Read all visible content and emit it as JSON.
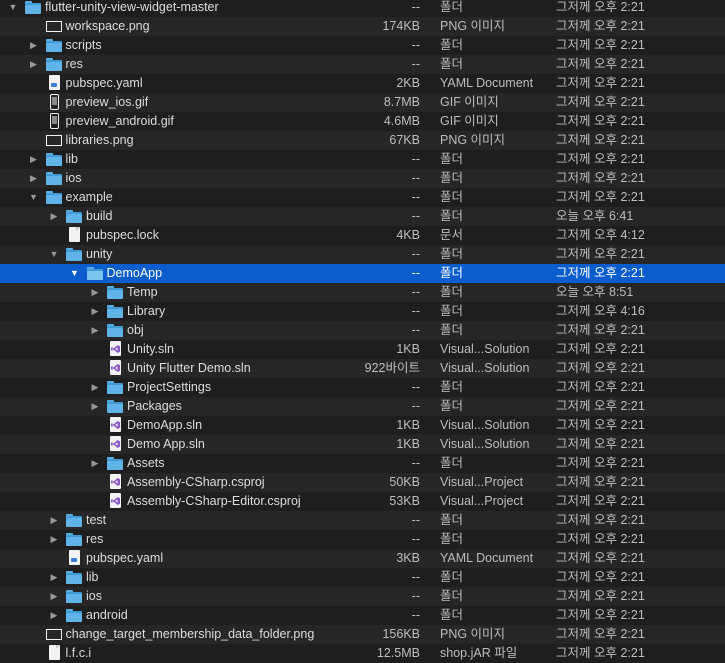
{
  "rows": [
    {
      "indent": 0,
      "disclosure": "open",
      "icon": "folder-icon",
      "name": "flutter-unity-view-widget-master",
      "size": "--",
      "kind": "폴더",
      "date": "그저께 오후 2:21"
    },
    {
      "indent": 1,
      "disclosure": "none",
      "icon": "png-file-icon",
      "name": "workspace.png",
      "size": "174KB",
      "kind": "PNG 이미지",
      "date": "그저께 오후 2:21"
    },
    {
      "indent": 1,
      "disclosure": "closed",
      "icon": "folder-icon",
      "name": "scripts",
      "size": "--",
      "kind": "폴더",
      "date": "그저께 오후 2:21"
    },
    {
      "indent": 1,
      "disclosure": "closed",
      "icon": "folder-icon",
      "name": "res",
      "size": "--",
      "kind": "폴더",
      "date": "그저께 오후 2:21"
    },
    {
      "indent": 1,
      "disclosure": "none",
      "icon": "yaml-file-icon",
      "name": "pubspec.yaml",
      "size": "2KB",
      "kind": "YAML Document",
      "date": "그저께 오후 2:21"
    },
    {
      "indent": 1,
      "disclosure": "none",
      "icon": "gif-file-icon",
      "name": "preview_ios.gif",
      "size": "8.7MB",
      "kind": "GIF 이미지",
      "date": "그저께 오후 2:21"
    },
    {
      "indent": 1,
      "disclosure": "none",
      "icon": "gif-file-icon",
      "name": "preview_android.gif",
      "size": "4.6MB",
      "kind": "GIF 이미지",
      "date": "그저께 오후 2:21"
    },
    {
      "indent": 1,
      "disclosure": "none",
      "icon": "png-file-icon",
      "name": "libraries.png",
      "size": "67KB",
      "kind": "PNG 이미지",
      "date": "그저께 오후 2:21"
    },
    {
      "indent": 1,
      "disclosure": "closed",
      "icon": "folder-icon",
      "name": "lib",
      "size": "--",
      "kind": "폴더",
      "date": "그저께 오후 2:21"
    },
    {
      "indent": 1,
      "disclosure": "closed",
      "icon": "folder-icon",
      "name": "ios",
      "size": "--",
      "kind": "폴더",
      "date": "그저께 오후 2:21"
    },
    {
      "indent": 1,
      "disclosure": "open",
      "icon": "folder-icon",
      "name": "example",
      "size": "--",
      "kind": "폴더",
      "date": "그저께 오후 2:21"
    },
    {
      "indent": 2,
      "disclosure": "closed",
      "icon": "folder-icon",
      "name": "build",
      "size": "--",
      "kind": "폴더",
      "date": "오늘 오후 6:41"
    },
    {
      "indent": 2,
      "disclosure": "none",
      "icon": "document-icon",
      "name": "pubspec.lock",
      "size": "4KB",
      "kind": "문서",
      "date": "그저께 오후 4:12"
    },
    {
      "indent": 2,
      "disclosure": "open",
      "icon": "folder-icon",
      "name": "unity",
      "size": "--",
      "kind": "폴더",
      "date": "그저께 오후 2:21"
    },
    {
      "indent": 3,
      "disclosure": "open",
      "icon": "folder-icon",
      "name": "DemoApp",
      "size": "--",
      "kind": "폴더",
      "date": "그저께 오후 2:21",
      "selected": true
    },
    {
      "indent": 4,
      "disclosure": "closed",
      "icon": "folder-icon",
      "name": "Temp",
      "size": "--",
      "kind": "폴더",
      "date": "오늘 오후 8:51"
    },
    {
      "indent": 4,
      "disclosure": "closed",
      "icon": "folder-icon",
      "name": "Library",
      "size": "--",
      "kind": "폴더",
      "date": "그저께 오후 4:16"
    },
    {
      "indent": 4,
      "disclosure": "closed",
      "icon": "folder-icon",
      "name": "obj",
      "size": "--",
      "kind": "폴더",
      "date": "그저께 오후 2:21"
    },
    {
      "indent": 4,
      "disclosure": "none",
      "icon": "visual-studio-icon",
      "name": "Unity.sln",
      "size": "1KB",
      "kind": "Visual...Solution",
      "date": "그저께 오후 2:21"
    },
    {
      "indent": 4,
      "disclosure": "none",
      "icon": "visual-studio-icon",
      "name": "Unity Flutter Demo.sln",
      "size": "922바이트",
      "kind": "Visual...Solution",
      "date": "그저께 오후 2:21"
    },
    {
      "indent": 4,
      "disclosure": "closed",
      "icon": "folder-icon",
      "name": "ProjectSettings",
      "size": "--",
      "kind": "폴더",
      "date": "그저께 오후 2:21"
    },
    {
      "indent": 4,
      "disclosure": "closed",
      "icon": "folder-icon",
      "name": "Packages",
      "size": "--",
      "kind": "폴더",
      "date": "그저께 오후 2:21"
    },
    {
      "indent": 4,
      "disclosure": "none",
      "icon": "visual-studio-icon",
      "name": "DemoApp.sln",
      "size": "1KB",
      "kind": "Visual...Solution",
      "date": "그저께 오후 2:21"
    },
    {
      "indent": 4,
      "disclosure": "none",
      "icon": "visual-studio-icon",
      "name": "Demo App.sln",
      "size": "1KB",
      "kind": "Visual...Solution",
      "date": "그저께 오후 2:21"
    },
    {
      "indent": 4,
      "disclosure": "closed",
      "icon": "folder-icon",
      "name": "Assets",
      "size": "--",
      "kind": "폴더",
      "date": "그저께 오후 2:21"
    },
    {
      "indent": 4,
      "disclosure": "none",
      "icon": "visual-studio-icon",
      "name": "Assembly-CSharp.csproj",
      "size": "50KB",
      "kind": "Visual...Project",
      "date": "그저께 오후 2:21"
    },
    {
      "indent": 4,
      "disclosure": "none",
      "icon": "visual-studio-icon",
      "name": "Assembly-CSharp-Editor.csproj",
      "size": "53KB",
      "kind": "Visual...Project",
      "date": "그저께 오후 2:21"
    },
    {
      "indent": 2,
      "disclosure": "closed",
      "icon": "folder-icon",
      "name": "test",
      "size": "--",
      "kind": "폴더",
      "date": "그저께 오후 2:21"
    },
    {
      "indent": 2,
      "disclosure": "closed",
      "icon": "folder-icon",
      "name": "res",
      "size": "--",
      "kind": "폴더",
      "date": "그저께 오후 2:21"
    },
    {
      "indent": 2,
      "disclosure": "none",
      "icon": "yaml-file-icon",
      "name": "pubspec.yaml",
      "size": "3KB",
      "kind": "YAML Document",
      "date": "그저께 오후 2:21"
    },
    {
      "indent": 2,
      "disclosure": "closed",
      "icon": "folder-icon",
      "name": "lib",
      "size": "--",
      "kind": "폴더",
      "date": "그저께 오후 2:21"
    },
    {
      "indent": 2,
      "disclosure": "closed",
      "icon": "folder-icon",
      "name": "ios",
      "size": "--",
      "kind": "폴더",
      "date": "그저께 오후 2:21"
    },
    {
      "indent": 2,
      "disclosure": "closed",
      "icon": "folder-icon",
      "name": "android",
      "size": "--",
      "kind": "폴더",
      "date": "그저께 오후 2:21"
    },
    {
      "indent": 1,
      "disclosure": "none",
      "icon": "png-file-icon",
      "name": "change_target_membership_data_folder.png",
      "size": "156KB",
      "kind": "PNG 이미지",
      "date": "그저께 오후 2:21"
    },
    {
      "indent": 1,
      "disclosure": "none",
      "icon": "document-icon",
      "name": "l.f.c.i",
      "size": "12.5MB",
      "kind": "shop.jAR 파일",
      "date": "그저께 오후 2:21"
    }
  ],
  "colors": {
    "background": "#1e1e1e",
    "selection": "#0b5ccc",
    "folder": "#5fb3e8"
  }
}
